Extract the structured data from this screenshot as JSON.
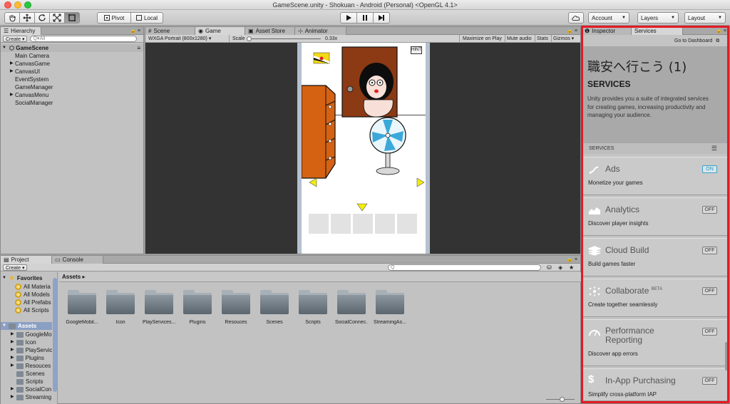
{
  "window": {
    "title": "GameScene.unity - Shokuan - Android (Personal) <OpenGL 4.1>"
  },
  "toolbar": {
    "pivot_label": "Pivot",
    "local_label": "Local",
    "account_label": "Account",
    "layers_label": "Layers",
    "layout_label": "Layout"
  },
  "hierarchy": {
    "tab_label": "Hierarchy",
    "create_label": "Create",
    "search_placeholder": "All",
    "scene_name": "GameScene",
    "items": [
      "Main Camera",
      "CanvasGame",
      "CanvasUI",
      "EventSystem",
      "GameManager",
      "CanvasMenu",
      "SocialManager"
    ]
  },
  "scene_tabs": {
    "scene": "Scene",
    "game": "Game",
    "asset_store": "Asset Store",
    "animator": "Animator"
  },
  "game_toolbar": {
    "resolution": "WXGA Portrait (800x1280)",
    "scale_label": "Scale",
    "scale_value": "0.33x",
    "maximize": "Maximize on Play",
    "mute": "Mute audio",
    "stats": "Stats",
    "gizmos": "Gizmos"
  },
  "game": {
    "hint_label": "HINT"
  },
  "project": {
    "tab_label": "Project",
    "console_label": "Console",
    "create_label": "Create",
    "favorites_label": "Favorites",
    "favorites": [
      "All Materia",
      "All Models",
      "All Prefabs",
      "All Scripts"
    ],
    "assets_label": "Assets",
    "asset_tree": [
      "GoogleMo",
      "Icon",
      "PlayServic",
      "Plugins",
      "Resouces",
      "Scenes",
      "Scripts",
      "SocialCon",
      "Streaming"
    ],
    "breadcrumb": "Assets",
    "folders": [
      "GoogleMobil...",
      "Icon",
      "PlayServices...",
      "Plugins",
      "Resouces",
      "Scenes",
      "Scripts",
      "SocialConnec...",
      "StreamingAs..."
    ]
  },
  "services": {
    "inspector_tab": "Inspector",
    "services_tab": "Services",
    "dashboard_link": "Go to Dashboard",
    "project_title": "職安へ行こう (1)",
    "heading": "SERVICES",
    "description": "Unity provides you a suite of integrated services for creating games, increasing productivity and managing your audience.",
    "section_label": "SERVICES",
    "cards": [
      {
        "name": "Ads",
        "sub": "Monetize your games",
        "state": "ON",
        "icon": "ads-icon"
      },
      {
        "name": "Analytics",
        "sub": "Discover player insights",
        "state": "OFF",
        "icon": "analytics-icon"
      },
      {
        "name": "Cloud Build",
        "sub": "Build games faster",
        "state": "OFF",
        "icon": "cloud-build-icon"
      },
      {
        "name": "Collaborate",
        "beta": "BETA",
        "sub": "Create together seamlessly",
        "state": "OFF",
        "icon": "collaborate-icon"
      },
      {
        "name": "Performance",
        "name2": "Reporting",
        "sub": "Discover app errors",
        "state": "OFF",
        "icon": "performance-reporting-icon"
      },
      {
        "name": "In-App Purchasing",
        "sub": "Simplify cross-platform IAP",
        "state": "OFF",
        "icon": "iap-icon"
      }
    ]
  },
  "colors": {
    "highlight_border": "#e21b25",
    "on_toggle": "#3aa1c7"
  }
}
